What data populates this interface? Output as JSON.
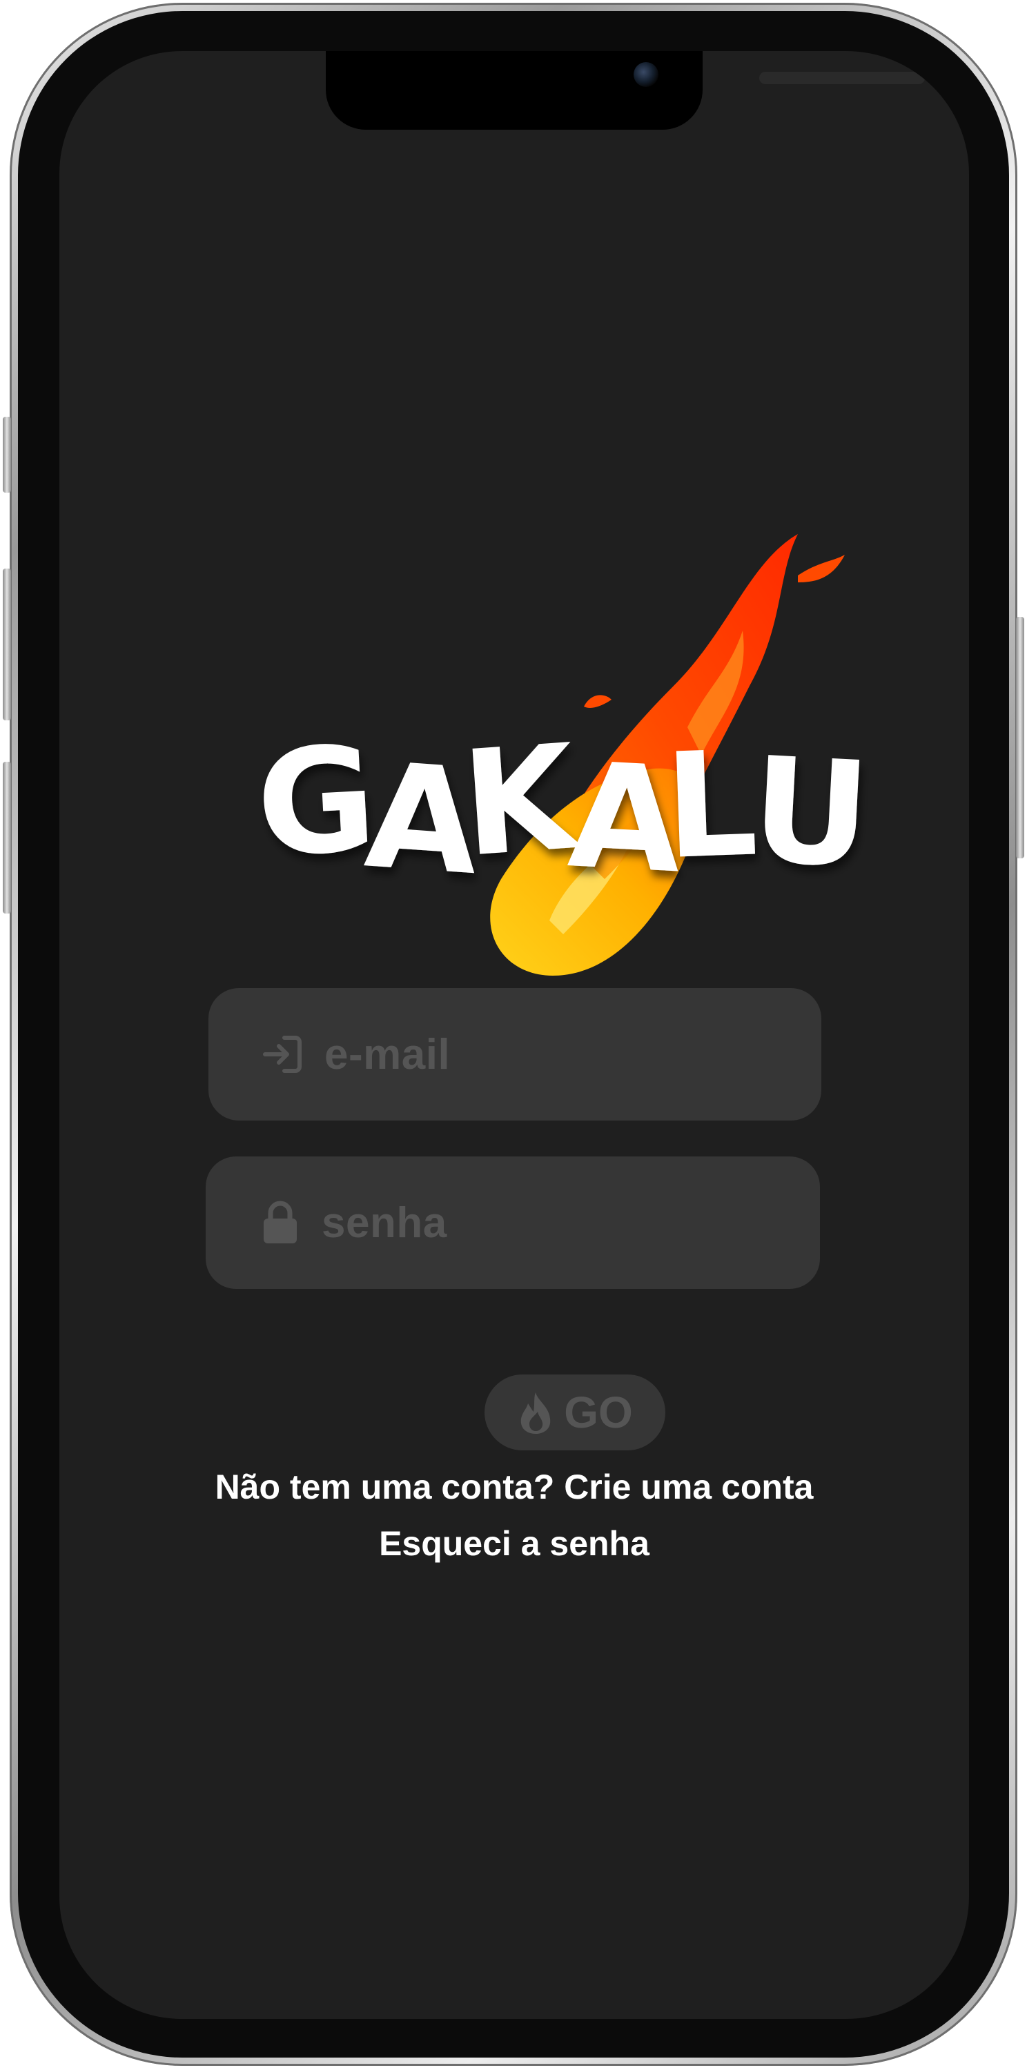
{
  "app": {
    "logo_text": "GAKALU"
  },
  "login": {
    "email_placeholder": "e-mail",
    "password_placeholder": "senha",
    "submit_label": "GO"
  },
  "links": {
    "signup_label": "Não tem uma conta? Crie uma conta",
    "forgot_label": "Esqueci a senha"
  },
  "icons": {
    "email": "login-arrow-icon",
    "password": "lock-icon",
    "submit": "flame-icon"
  },
  "colors": {
    "background": "#1f1f1f",
    "field": "#363636",
    "placeholder": "#555555",
    "text": "#ffffff",
    "flame_red": "#ff3b00",
    "flame_yellow": "#ffd21a"
  }
}
